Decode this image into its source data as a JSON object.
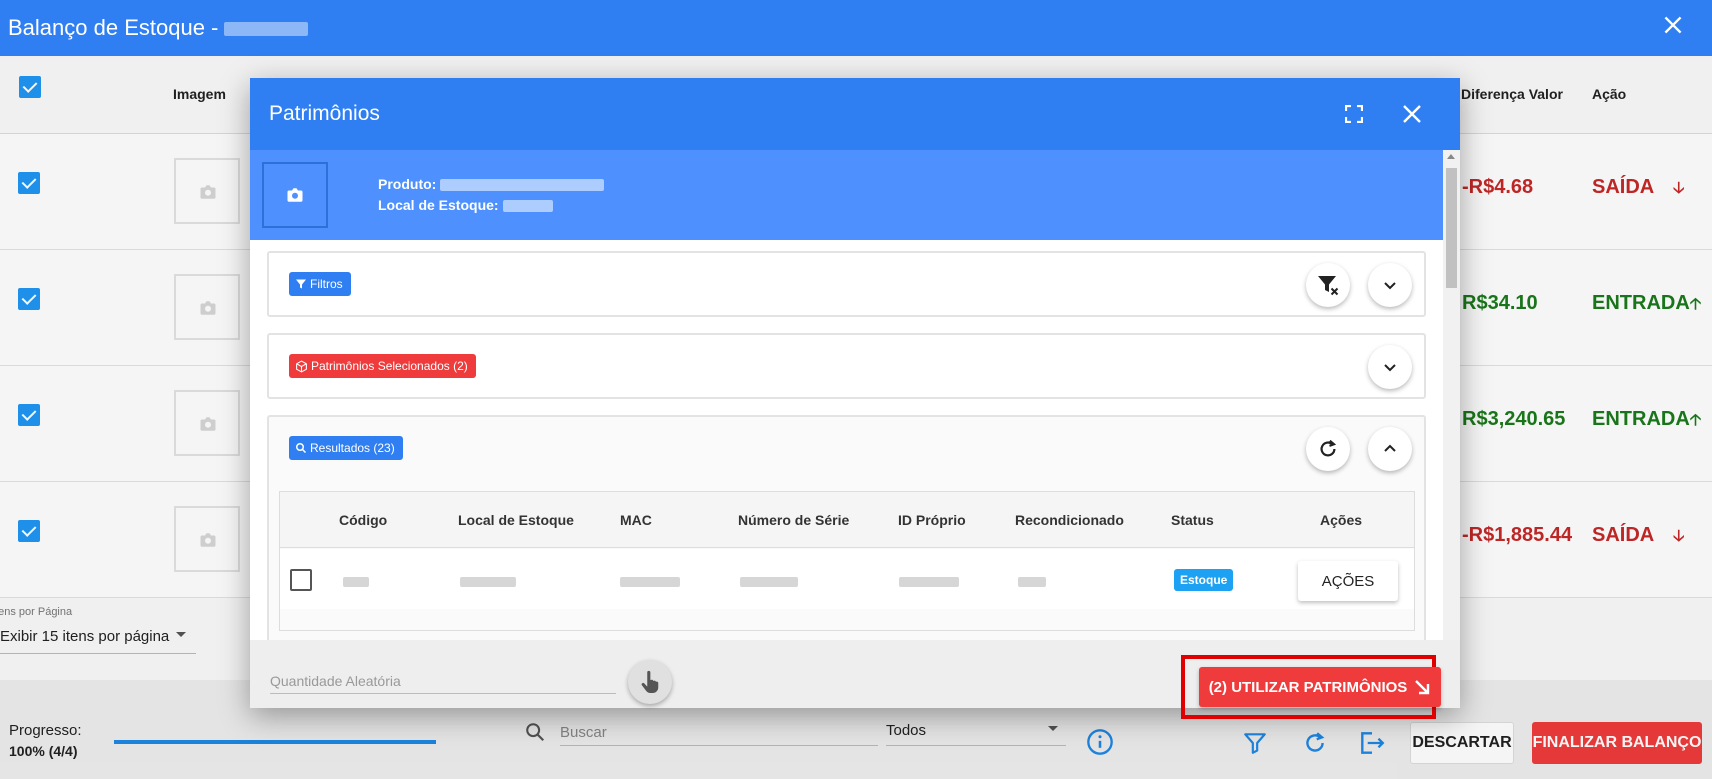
{
  "appbar": {
    "title": "Balanço de Estoque - "
  },
  "table": {
    "headers": {
      "image": "Imagem",
      "diff_value": "Diferença Valor",
      "action": "Ação"
    },
    "rows": [
      {
        "diff_value": "-R$4.68",
        "action": "SAÍDA",
        "direction": "down"
      },
      {
        "diff_value": "R$34.10",
        "action": "ENTRADA",
        "direction": "up"
      },
      {
        "diff_value": "R$3,240.65",
        "action": "ENTRADA",
        "direction": "up"
      },
      {
        "diff_value": "-R$1,885.44",
        "action": "SAÍDA",
        "direction": "down"
      }
    ],
    "per_page_label": "Itens por Página",
    "per_page_value": "Exibir 15 itens por página"
  },
  "bottom": {
    "progress_label": "Progresso:",
    "progress_value": "100% (4/4)",
    "progress_fraction": 1.0,
    "search_placeholder": "Buscar",
    "filter_select": "Todos",
    "discard": "DESCARTAR",
    "finalize": "FINALIZAR BALANÇO"
  },
  "dialog": {
    "title": "Patrimônios",
    "product_label": "Produto:",
    "location_label": "Local de Estoque:",
    "filters_chip": "Filtros",
    "selected_chip": "Patrimônios Selecionados (2)",
    "results_chip": "Resultados (23)",
    "columns": [
      "Código",
      "Local de Estoque",
      "MAC",
      "Número de Série",
      "ID Próprio",
      "Recondicionado",
      "Status",
      "Ações"
    ],
    "row": {
      "status": "Estoque",
      "actions": "AÇÕES"
    },
    "random_qty_placeholder": "Quantidade Aleatória",
    "use_button": "(2) UTILIZAR PATRIMÔNIOS"
  },
  "colors": {
    "primary": "#2f7ff3",
    "danger": "#ef3b3b",
    "positive": "#1b7a1b",
    "negative": "#c62828"
  }
}
